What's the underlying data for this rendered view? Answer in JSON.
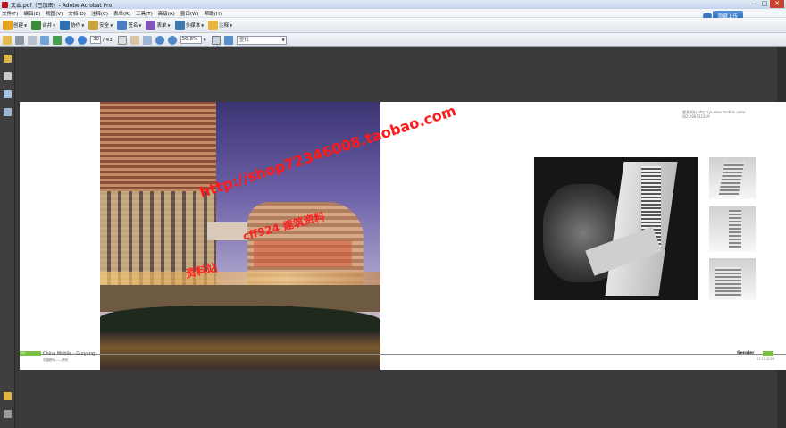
{
  "window": {
    "title": "文本.pdf（已加密）- Adobe Acrobat Pro",
    "controls": [
      "—",
      "□",
      "✕"
    ]
  },
  "menu": [
    "文件(F)",
    "编辑(E)",
    "视图(V)",
    "文档(D)",
    "注释(C)",
    "表单(R)",
    "工具(T)",
    "高级(A)",
    "窗口(W)",
    "帮助(H)"
  ],
  "upload_button": "隐藏上传",
  "toolbar1": [
    {
      "label": "创建",
      "icon": "create-icon",
      "color": "#e8a21c"
    },
    {
      "label": "合并",
      "icon": "combine-icon",
      "color": "#3a8a3a"
    },
    {
      "label": "协作",
      "icon": "collaborate-icon",
      "color": "#2c70b5"
    },
    {
      "label": "安全",
      "icon": "lock-icon",
      "color": "#caa23a"
    },
    {
      "label": "签名",
      "icon": "pen-icon",
      "color": "#4b7fc2"
    },
    {
      "label": "表单",
      "icon": "form-icon",
      "color": "#8057b8"
    },
    {
      "label": "多媒体",
      "icon": "multimedia-icon",
      "color": "#3b7bb0"
    },
    {
      "label": "注释",
      "icon": "comment-icon",
      "color": "#e7b53a"
    }
  ],
  "toolbar2": {
    "current_page": "30",
    "page_count": "/ 43",
    "zoom": "50.8%",
    "search_placeholder": "查找"
  },
  "page": {
    "site_line1": "更多资料 http://yi-shen.taobao.com/",
    "site_line2": "QQ:286732339",
    "footer_num": "40",
    "footer_title": "China Mobile - Guiyang",
    "footer_subtitle": "中国移动——贵阳",
    "footer_brand": "Gensler",
    "footer_date": "07.11.2009"
  },
  "watermarks": {
    "url": "http://shop72346008.taobao.com",
    "red_line2": "资料站",
    "red_line3": "cff924 建筑资料"
  },
  "colors": {
    "accent_green": "#7ac143",
    "watermark_red": "#ff1a1a"
  }
}
